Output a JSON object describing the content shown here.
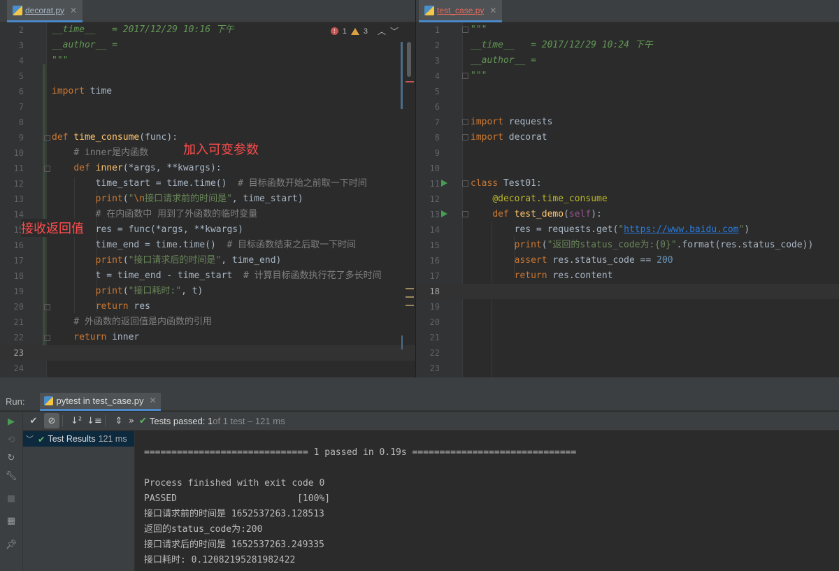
{
  "left_editor": {
    "tab_label": "decorat.py",
    "inspections": {
      "errors": "1",
      "warnings": "3"
    },
    "annotations": {
      "var_params": "加入可变参数",
      "receive_return": "接收返回值"
    },
    "lines": [
      {
        "n": "2",
        "html": "<span class=\"dc\">__time__   = 2017/12/29 10:16 下午</span>"
      },
      {
        "n": "3",
        "html": "<span class=\"dc\">__author__ = </span>"
      },
      {
        "n": "4",
        "html": "<span class=\"dc\">\"\"\"</span>"
      },
      {
        "n": "5",
        "html": ""
      },
      {
        "n": "6",
        "html": "<span class=\"kw\">import</span> time"
      },
      {
        "n": "7",
        "html": ""
      },
      {
        "n": "8",
        "html": ""
      },
      {
        "n": "9",
        "html": "<span class=\"kw\">def</span> <span class=\"fn\">time_consume</span>(func):"
      },
      {
        "n": "10",
        "html": "    <span class=\"cm\"># inner是内函数</span>"
      },
      {
        "n": "11",
        "html": "    <span class=\"kw\">def</span> <span class=\"fn\">inner</span>(*args, **kwargs):"
      },
      {
        "n": "12",
        "html": "        time_start = time.time()  <span class=\"cm\"># 目标函数开始之前取一下时间</span>"
      },
      {
        "n": "13",
        "html": "        <span class=\"kw\">print</span>(<span class=\"st\">\"</span><span class=\"kw\">\\n</span><span class=\"st\">接口请求前的时间是\"</span>, time_start)"
      },
      {
        "n": "14",
        "html": "        <span class=\"cm\"># 在内函数中 用到了外函数的临时变量</span>"
      },
      {
        "n": "15",
        "html": "        res = func(*args, **kwargs)"
      },
      {
        "n": "16",
        "html": "        time_end = time.time()  <span class=\"cm\"># 目标函数结束之后取一下时间</span>"
      },
      {
        "n": "17",
        "html": "        <span class=\"kw\">print</span>(<span class=\"st\">\"接口请求后的时间是\"</span>, time_end)"
      },
      {
        "n": "18",
        "html": "        t = time_end - time_start  <span class=\"cm\"># 计算目标函数执行花了多长时间</span>"
      },
      {
        "n": "19",
        "html": "        <span class=\"kw\">print</span>(<span class=\"st\">\"接口耗时:\"</span>, t)"
      },
      {
        "n": "20",
        "html": "        <span class=\"kw\">return</span> res"
      },
      {
        "n": "21",
        "html": "    <span class=\"cm\"># 外函数的返回值是内函数的引用</span>"
      },
      {
        "n": "22",
        "html": "    <span class=\"kw\">return</span> inner"
      },
      {
        "n": "23",
        "html": "",
        "current": true
      },
      {
        "n": "24",
        "html": ""
      }
    ]
  },
  "right_editor": {
    "tab_label": "test_case.py",
    "lines": [
      {
        "n": "1",
        "html": "<span class=\"dc\">\"\"\"</span>"
      },
      {
        "n": "2",
        "html": "<span class=\"dc\">__time__   = 2017/12/29 10:24 下午</span>"
      },
      {
        "n": "3",
        "html": "<span class=\"dc\">__author__ = </span>"
      },
      {
        "n": "4",
        "html": "<span class=\"dc\">\"\"\"</span>"
      },
      {
        "n": "5",
        "html": ""
      },
      {
        "n": "6",
        "html": ""
      },
      {
        "n": "7",
        "html": "<span class=\"kw\">import</span> requests"
      },
      {
        "n": "8",
        "html": "<span class=\"kw\">import</span> decorat"
      },
      {
        "n": "9",
        "html": ""
      },
      {
        "n": "10",
        "html": ""
      },
      {
        "n": "11",
        "html": "<span class=\"kw\">class</span> Test01:"
      },
      {
        "n": "12",
        "html": "    <span class=\"dec\">@decorat.time_consume</span>"
      },
      {
        "n": "13",
        "html": "    <span class=\"kw\">def</span> <span class=\"fn\">test_demo</span>(<span class=\"slf\">self</span>):"
      },
      {
        "n": "14",
        "html": "        res = requests.get(<span class=\"st\">\"</span><span class=\"url\">https://www.baidu.com</span><span class=\"st\">\"</span>)"
      },
      {
        "n": "15",
        "html": "        <span class=\"kw\">print</span>(<span class=\"st\">\"返回的status_code为:{0}\"</span>.format(res.status_code))"
      },
      {
        "n": "16",
        "html": "        <span class=\"kw\">assert</span> res.status_code == <span class=\"nu\">200</span>"
      },
      {
        "n": "17",
        "html": "        <span class=\"kw\">return</span> res.content"
      },
      {
        "n": "18",
        "html": "",
        "current": true
      },
      {
        "n": "19",
        "html": ""
      },
      {
        "n": "20",
        "html": ""
      },
      {
        "n": "21",
        "html": ""
      },
      {
        "n": "22",
        "html": ""
      },
      {
        "n": "23",
        "html": ""
      }
    ]
  },
  "run_panel": {
    "label": "Run:",
    "tab_label": "pytest in test_case.py",
    "status_bold": "Tests passed: 1",
    "status_rest": " of 1 test – 121 ms",
    "tree_label": "Test Results",
    "tree_time": "121 ms",
    "console_lines": [
      "============================== 1 passed in 0.19s ==============================",
      "",
      "Process finished with exit code 0",
      "PASSED                      [100%]",
      "接口请求前的时间是 1652537263.128513",
      "返回的status_code为:200",
      "接口请求后的时间是 1652537263.249335",
      "接口耗时: 0.12082195281982422"
    ]
  },
  "colors": {
    "accent": "#4a88c7",
    "pass_green": "#5fb865",
    "annotation_red": "#ff4d4d"
  }
}
